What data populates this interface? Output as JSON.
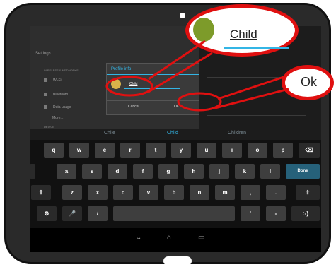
{
  "settings": {
    "title": "Settings",
    "section_wireless": "WIRELESS & NETWORKS",
    "items": [
      {
        "label": "Wi-Fi",
        "icon": "wifi-icon"
      },
      {
        "label": "Bluetooth",
        "icon": "bluetooth-icon"
      },
      {
        "label": "Data usage",
        "icon": "data-usage-icon"
      },
      {
        "label": "More..."
      }
    ],
    "section_device": "DEVICE",
    "status_time": "12:5"
  },
  "dialog": {
    "title": "Profile info",
    "name_value": "Child",
    "cancel_label": "Cancel",
    "ok_label": "OK"
  },
  "keyboard": {
    "suggestions": [
      "Chile",
      "Child",
      "Children"
    ],
    "row1": [
      "q",
      "w",
      "e",
      "r",
      "t",
      "y",
      "u",
      "i",
      "o",
      "p"
    ],
    "row2": [
      "a",
      "s",
      "d",
      "f",
      "g",
      "h",
      "j",
      "k",
      "l"
    ],
    "row3": [
      "z",
      "x",
      "c",
      "v",
      "b",
      "n",
      "m",
      ",",
      "."
    ],
    "row4": [
      "/",
      "'",
      "-"
    ],
    "done_label": "Done",
    "emoticon_label": ":-)"
  },
  "callouts": {
    "child_text": "Child",
    "ok_text": "Ok"
  },
  "colors": {
    "accent": "#33b5e5",
    "annotation": "#e01010"
  }
}
